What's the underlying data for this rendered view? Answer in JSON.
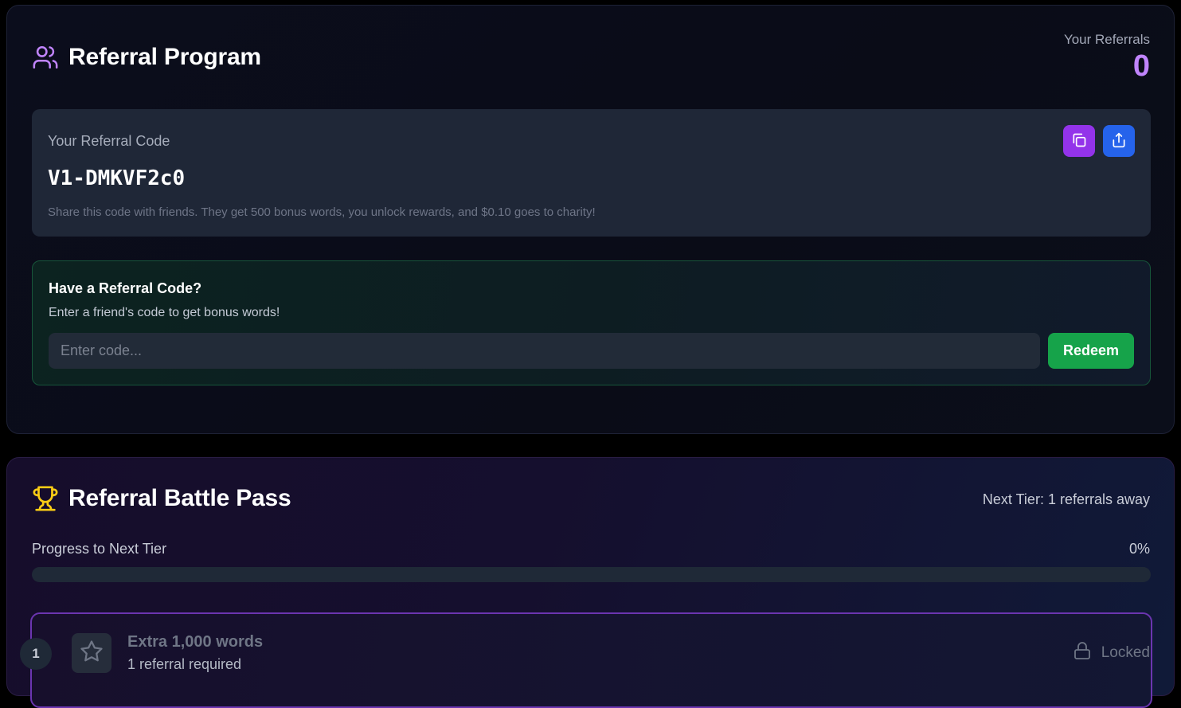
{
  "referral": {
    "title": "Referral Program",
    "stats_label": "Your Referrals",
    "stats_count": "0",
    "code_label": "Your Referral Code",
    "code": "V1-DMKVF2c0",
    "code_hint": "Share this code with friends. They get 500 bonus words, you unlock rewards, and $0.10 goes to charity!",
    "icons": {
      "header": "users-icon",
      "copy": "copy-icon",
      "share": "share-icon"
    }
  },
  "redeem": {
    "title": "Have a Referral Code?",
    "subtitle": "Enter a friend's code to get bonus words!",
    "input_value": "",
    "input_placeholder": "Enter code...",
    "button_label": "Redeem"
  },
  "battle_pass": {
    "title": "Referral Battle Pass",
    "next_tier_text": "Next Tier: 1 referrals away",
    "progress_label": "Progress to Next Tier",
    "progress_percent_text": "0%",
    "progress_fraction": 0,
    "icon": "trophy-icon",
    "tiers": [
      {
        "number": "1",
        "title": "Extra 1,000 words",
        "requirement": "1 referral required",
        "status": "Locked",
        "icon": "star-icon",
        "status_icon": "lock-icon"
      }
    ]
  },
  "colors": {
    "accent_purple": "#c084fc",
    "copy_button": "#9333ea",
    "share_button": "#2563eb",
    "redeem_button": "#16a34a",
    "trophy": "#facc15"
  }
}
